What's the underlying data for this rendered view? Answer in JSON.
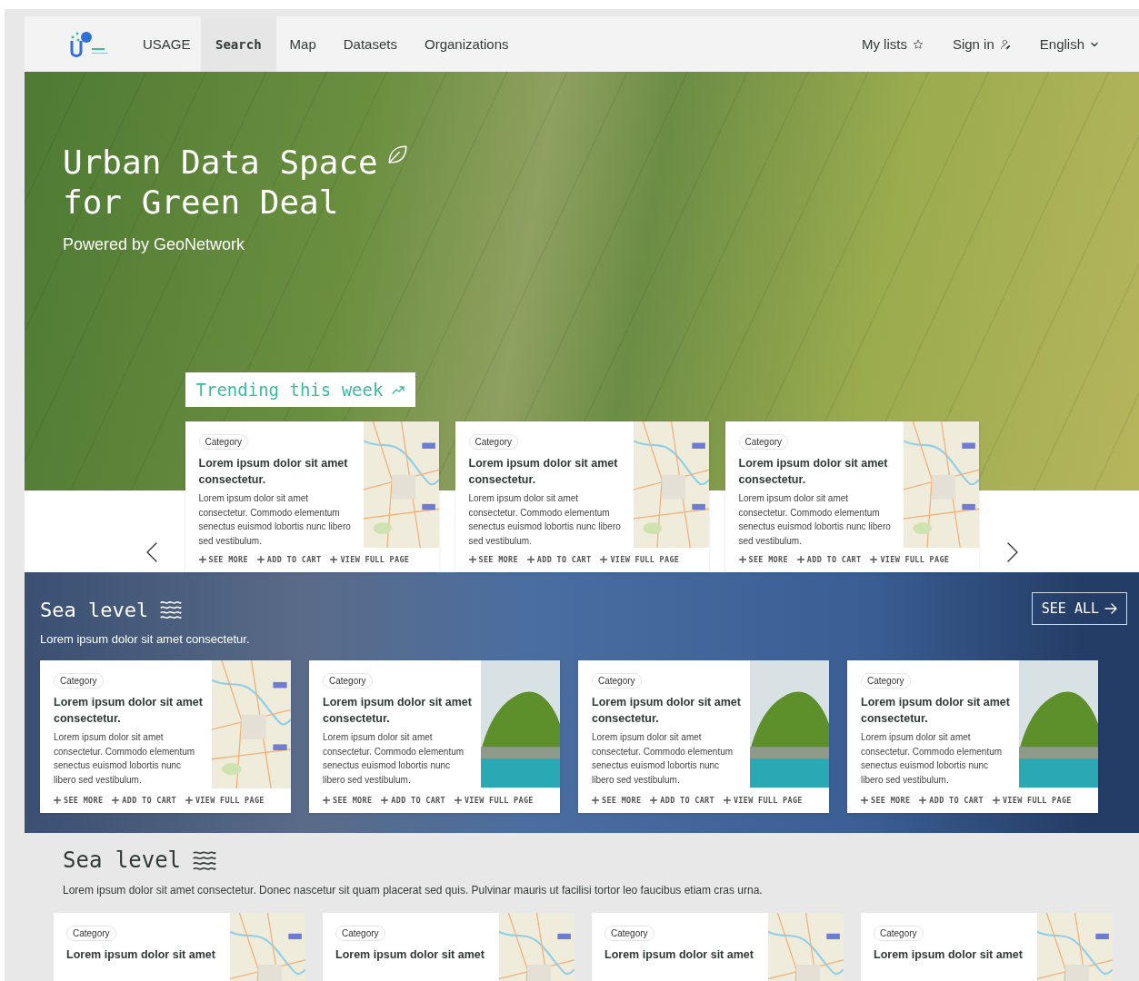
{
  "nav": {
    "brand": "USAGE",
    "links": [
      {
        "label": "Search",
        "selected": true
      },
      {
        "label": "Map",
        "selected": false
      },
      {
        "label": "Datasets",
        "selected": false
      },
      {
        "label": "Organizations",
        "selected": false
      }
    ],
    "actions": [
      {
        "label": "My lists",
        "kind": "star"
      },
      {
        "label": "Sign in",
        "kind": "user"
      },
      {
        "label": "English",
        "kind": "caret"
      }
    ]
  },
  "hero": {
    "title_lines": [
      "Urban Data Space",
      "for Green Deal"
    ],
    "subtitle": "Powered by GeoNetwork"
  },
  "trending": {
    "title": "Trending this week",
    "cards": [
      {
        "category": "Category",
        "title": "Lorem ipsum dolor sit amet consectetur.",
        "description": "Lorem ipsum dolor sit amet consectetur. Commodo elementum senectus euismod lobortis nunc libero sed vestibulum.",
        "kind": "map",
        "actions": [
          "SEE MORE",
          "ADD TO CART",
          "VIEW FULL PAGE"
        ]
      },
      {
        "category": "Category",
        "title": "Lorem ipsum dolor sit amet consectetur.",
        "description": "Lorem ipsum dolor sit amet consectetur. Commodo elementum senectus euismod lobortis nunc libero sed vestibulum.",
        "kind": "map",
        "actions": [
          "SEE MORE",
          "ADD TO CART",
          "VIEW FULL PAGE"
        ]
      },
      {
        "category": "Category",
        "title": "Lorem ipsum dolor sit amet consectetur.",
        "description": "Lorem ipsum dolor sit amet consectetur. Commodo elementum senectus euismod lobortis nunc libero sed vestibulum.",
        "kind": "map",
        "actions": [
          "SEE MORE",
          "ADD TO CART",
          "VIEW FULL PAGE"
        ]
      }
    ]
  },
  "sea_band": {
    "title": "Sea level",
    "subtitle": "Lorem ipsum dolor sit amet consectetur.",
    "see_all": "SEE ALL",
    "cards": [
      {
        "category": "Category",
        "title": "Lorem ipsum dolor sit amet consectetur.",
        "description": "Lorem ipsum dolor sit amet consectetur. Commodo elementum senectus euismod lobortis nunc libero sed vestibulum.",
        "kind": "map",
        "actions": [
          "SEE MORE",
          "ADD TO CART",
          "VIEW FULL PAGE"
        ]
      },
      {
        "category": "Category",
        "title": "Lorem ipsum dolor sit amet consectetur.",
        "description": "Lorem ipsum dolor sit amet consectetur. Commodo elementum senectus euismod lobortis nunc libero sed vestibulum.",
        "kind": "island",
        "actions": [
          "SEE MORE",
          "ADD TO CART",
          "VIEW FULL PAGE"
        ]
      },
      {
        "category": "Category",
        "title": "Lorem ipsum dolor sit amet consectetur.",
        "description": "Lorem ipsum dolor sit amet consectetur. Commodo elementum senectus euismod lobortis nunc libero sed vestibulum.",
        "kind": "island",
        "actions": [
          "SEE MORE",
          "ADD TO CART",
          "VIEW FULL PAGE"
        ]
      },
      {
        "category": "Category",
        "title": "Lorem ipsum dolor sit amet consectetur.",
        "description": "Lorem ipsum dolor sit amet consectetur. Commodo elementum senectus euismod lobortis nunc libero sed vestibulum.",
        "kind": "island",
        "actions": [
          "SEE MORE",
          "ADD TO CART",
          "VIEW FULL PAGE"
        ]
      }
    ]
  },
  "sea_section": {
    "title": "Sea level",
    "description": "Lorem ipsum dolor sit amet consectetur. Donec nascetur sit quam placerat sed quis. Pulvinar mauris ut facilisi tortor leo faucibus etiam cras urna.",
    "cards": [
      {
        "category": "Category",
        "title": "Lorem ipsum dolor sit amet",
        "kind": "map"
      },
      {
        "category": "Category",
        "title": "Lorem ipsum dolor sit amet",
        "kind": "map"
      },
      {
        "category": "Category",
        "title": "Lorem ipsum dolor sit amet",
        "kind": "map"
      },
      {
        "category": "Category",
        "title": "Lorem ipsum dolor sit amet",
        "kind": "map"
      }
    ]
  }
}
